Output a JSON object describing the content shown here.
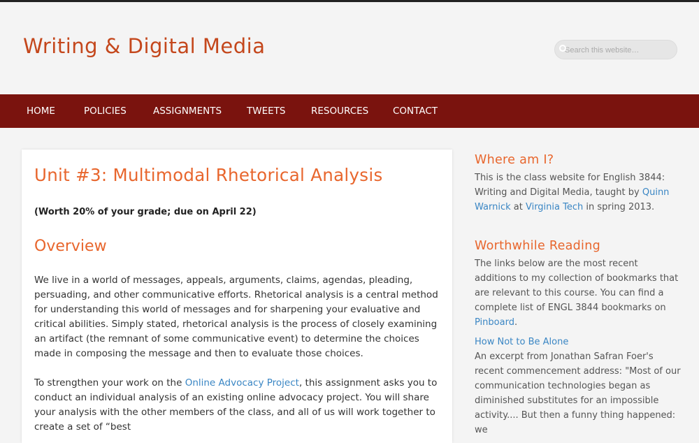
{
  "site": {
    "title": "Writing & Digital Media"
  },
  "search": {
    "placeholder": "Search this website…"
  },
  "nav": {
    "items": [
      {
        "label": "HOME"
      },
      {
        "label": "POLICIES"
      },
      {
        "label": "ASSIGNMENTS"
      },
      {
        "label": "TWEETS"
      },
      {
        "label": "RESOURCES"
      },
      {
        "label": "CONTACT"
      }
    ]
  },
  "article": {
    "title": "Unit #3: Multimodal Rhetorical Analysis",
    "worth": "(Worth 20% of your grade; due on April 22)",
    "overview_heading": "Overview",
    "para1": "We live in a world of messages, appeals, arguments, claims, agendas, pleading, persuading, and other communicative efforts. Rhetorical analysis is a central method for understanding this world of messages and for sharpening your evaluative and critical abilities. Simply stated, rhetorical analysis is the process of closely examining an artifact (the remnant of some communicative event) to determine the choices made in composing the message and then to evaluate those choices.",
    "para2_before": "To strengthen your work on the ",
    "para2_link": "Online Advocacy Project",
    "para2_after": ", this assignment asks you to conduct an individual analysis of an existing online advocacy project. You will share your analysis with the other members of the class, and all of us will work together to create a set of “best"
  },
  "sidebar": {
    "where": {
      "title": "Where am I?",
      "text1": "This is the class website for English 3844: Writing and Digital Media, taught by ",
      "link1": "Quinn Warnick",
      "text2": " at ",
      "link2": "Virginia Tech",
      "text3": " in spring 2013."
    },
    "reading": {
      "title": "Worthwhile Reading",
      "text1": "The links below are the most recent additions to my collection of bookmarks that are relevant to this course. You can find a complete list of ENGL 3844 bookmarks on ",
      "link": "Pinboard",
      "text2": ".",
      "item_link": "How Not to Be Alone",
      "item_text": "An excerpt from Jonathan Safran Foer's recent commencement address: \"Most of our communication technologies began as diminished substitutes for an impossible activity.... But then a funny thing happened: we"
    }
  },
  "colors": {
    "nav_bg": "#7a130e",
    "title": "#c4471c",
    "heading": "#e8662d",
    "link": "#3a86c4"
  }
}
